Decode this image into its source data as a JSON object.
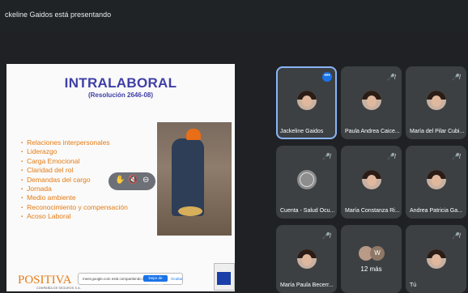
{
  "banner": {
    "text": "ckeline Gaidos está presentando"
  },
  "slide": {
    "title": "INTRALABORAL",
    "subtitle": "(Resolución 2646-08)",
    "bullets": [
      "Relaciones interpersonales",
      "Liderazgo",
      "Carga Emocional",
      "Claridad del rol",
      "Demandas del cargo",
      "Jornada",
      "Medio ambiente",
      "Reconocimiento y compensación",
      "Acoso Laboral"
    ],
    "logo": "POSITIVA",
    "logo_tagline": "COMPAÑÍA DE SEGUROS S.A.",
    "share_notice": "meet.google.com está compartiendo tu pantalla.",
    "stop_share": "Dejar de compartir",
    "hide": "Ocultar"
  },
  "participants": [
    {
      "name": "Jackeline Gaidos",
      "more_menu": "•••"
    },
    {
      "name": "Paula Andrea Caice...",
      "muted_icon": "mic-off-icon"
    },
    {
      "name": "María del Pilar Cubi...",
      "muted_icon": "mic-off-icon"
    },
    {
      "name": "Cuenta - Salud Ocu...",
      "muted_icon": "mic-off-icon"
    },
    {
      "name": "María Constanza Ri...",
      "muted_icon": "mic-off-icon"
    },
    {
      "name": "Andrea Patricia Ga...",
      "muted_icon": "mic-off-icon"
    },
    {
      "name": "María Paula Becerr...",
      "muted_icon": "mic-off-icon"
    },
    {
      "more_label": "12 más",
      "initial": "W"
    },
    {
      "name": "Tú",
      "muted_icon": "mic-off-icon"
    }
  ],
  "colors": {
    "accent": "#8ab4f8",
    "tile": "#3c4043",
    "background": "#202124",
    "slide_title": "#3f3fa6",
    "bullet": "#e47b14"
  }
}
